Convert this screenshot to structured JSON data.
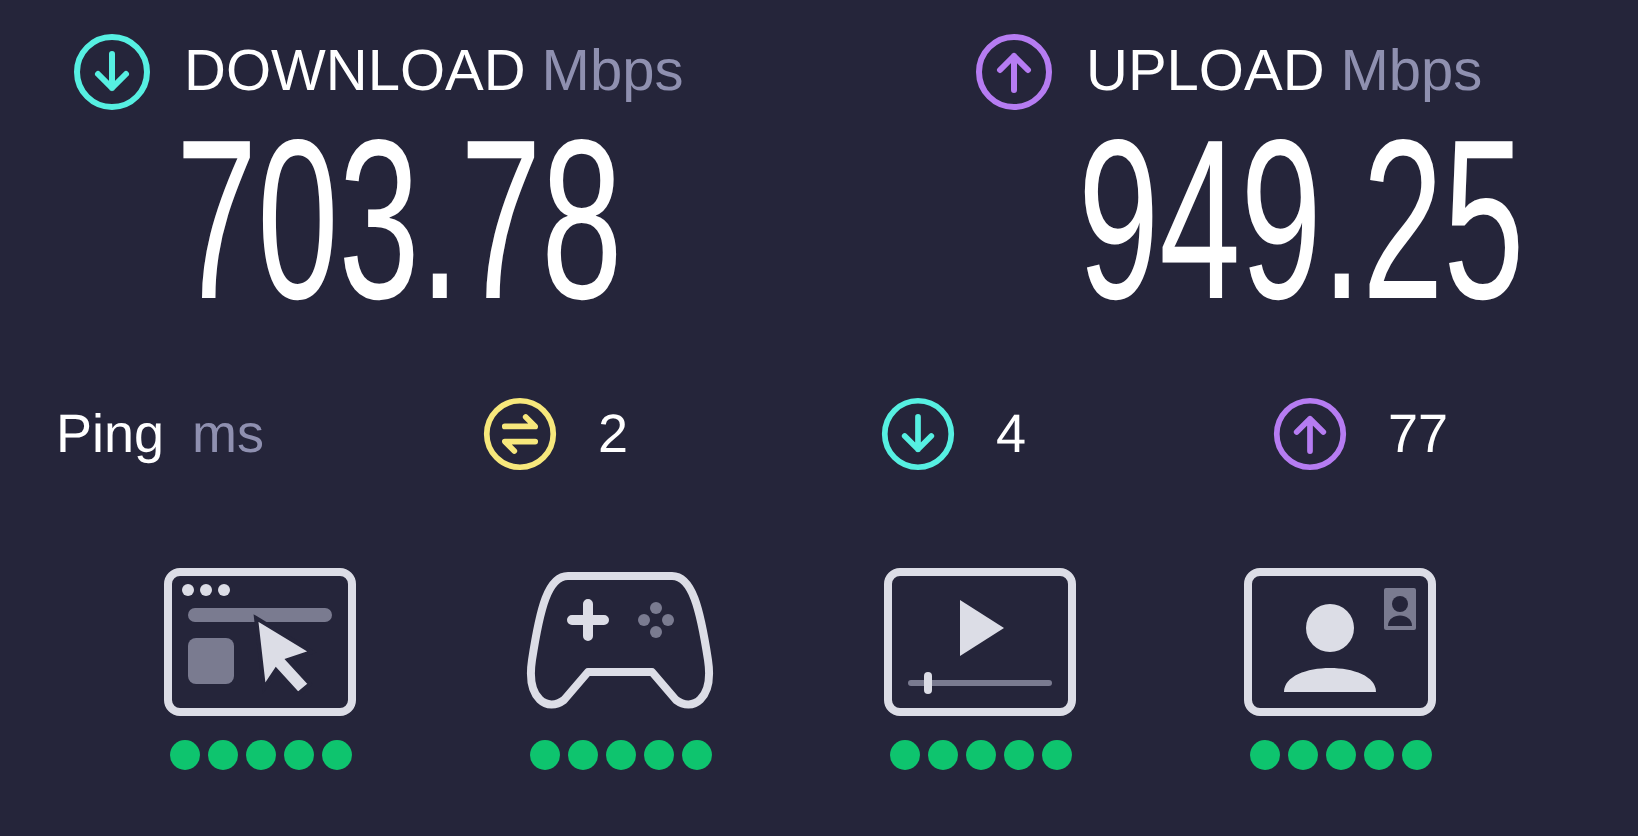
{
  "speeds": [
    {
      "kind": "download",
      "label": "DOWNLOAD",
      "unit": "Mbps",
      "value": "703.78"
    },
    {
      "kind": "upload",
      "label": "UPLOAD",
      "unit": "Mbps",
      "value": "949.25"
    }
  ],
  "ping": {
    "label": "Ping",
    "unit": "ms",
    "items": [
      {
        "kind": "idle",
        "value": "2"
      },
      {
        "kind": "download",
        "value": "4"
      },
      {
        "kind": "upload",
        "value": "77"
      }
    ]
  },
  "ratings": [
    {
      "kind": "browsing",
      "stars": 5
    },
    {
      "kind": "gaming",
      "stars": 5
    },
    {
      "kind": "streaming",
      "stars": 5
    },
    {
      "kind": "video_call",
      "stars": 5
    }
  ]
}
